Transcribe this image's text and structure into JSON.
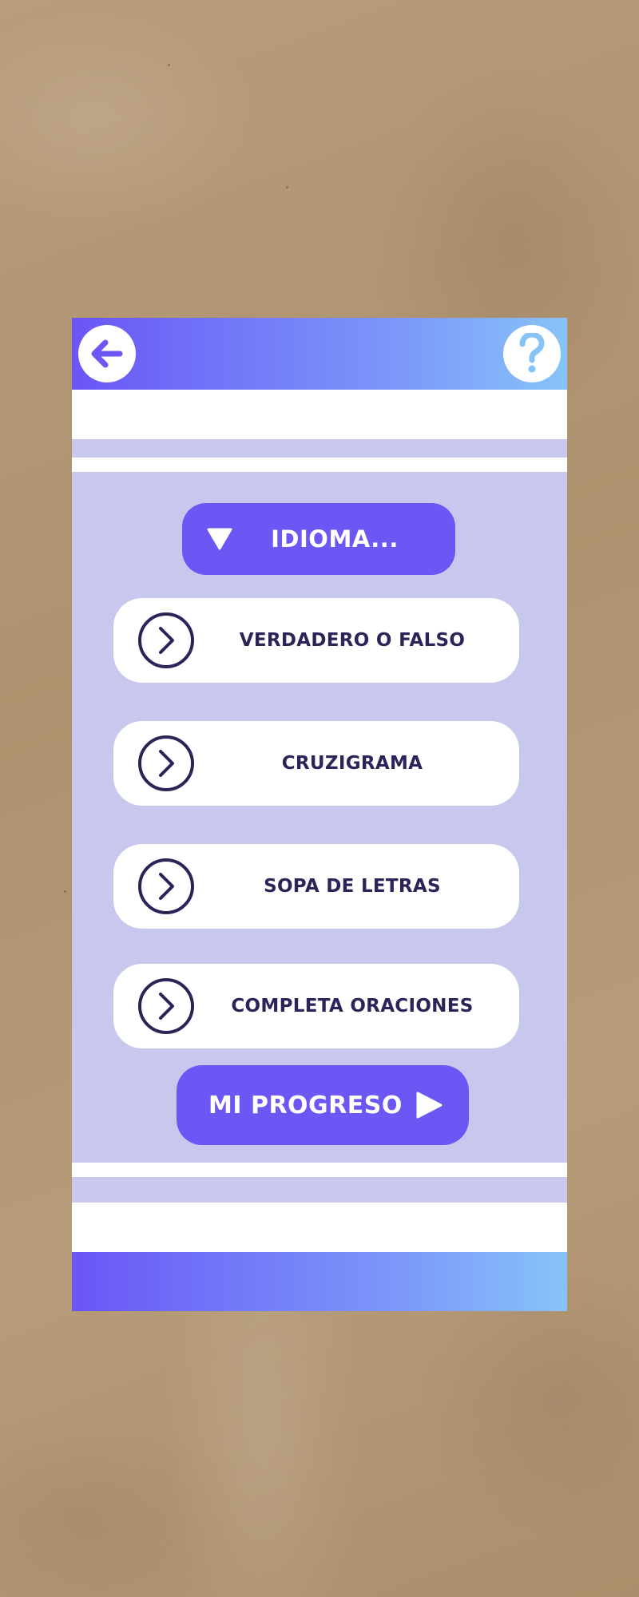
{
  "header": {
    "back_icon": "arrow-left-icon",
    "help_icon": "question-mark-icon"
  },
  "language": {
    "label": "IDIOMA...",
    "icon": "triangle-down-icon"
  },
  "games": [
    {
      "label": "VERDADERO O FALSO",
      "icon": "chevron-right-circle-icon"
    },
    {
      "label": "CRUZIGRAMA",
      "icon": "chevron-right-circle-icon"
    },
    {
      "label": "SOPA DE LETRAS",
      "icon": "chevron-right-circle-icon"
    },
    {
      "label": "COMPLETA ORACIONES",
      "icon": "chevron-right-circle-icon"
    }
  ],
  "progress": {
    "label": "MI PROGRESO",
    "icon": "play-icon"
  },
  "colors": {
    "accent": "#6c56f4",
    "panel": "#c8c8ef",
    "text_dark": "#2b2459",
    "gradient_start": "#6b55f6",
    "gradient_end": "#86c4f8"
  }
}
